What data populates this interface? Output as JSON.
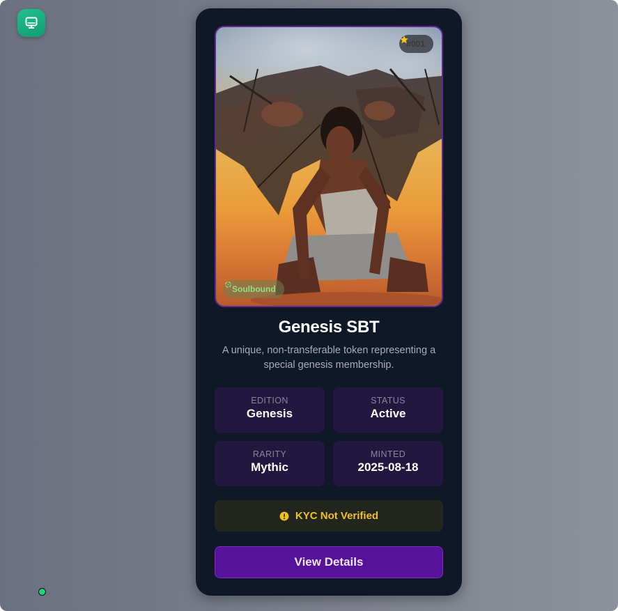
{
  "app": {
    "icon": "monitor-icon",
    "accent": "#16a87d"
  },
  "status_indicator": {
    "color": "#22d37a"
  },
  "card": {
    "edition_badge": {
      "icon": "star-icon",
      "text": "#001"
    },
    "soulbound_badge": {
      "icon": "crosshair-icon",
      "text": "Soulbound"
    },
    "title": "Genesis SBT",
    "description": "A unique, non-transferable token representing a special genesis membership.",
    "stats": [
      {
        "label": "EDITION",
        "value": "Genesis"
      },
      {
        "label": "STATUS",
        "value": "Active"
      },
      {
        "label": "RARITY",
        "value": "Mythic"
      },
      {
        "label": "MINTED",
        "value": "2025-08-18"
      }
    ],
    "kyc": {
      "icon": "alert-circle-icon",
      "text": "KYC Not Verified",
      "color": "#f0c020"
    },
    "cta": {
      "label": "View Details",
      "color": "#56129b"
    }
  }
}
